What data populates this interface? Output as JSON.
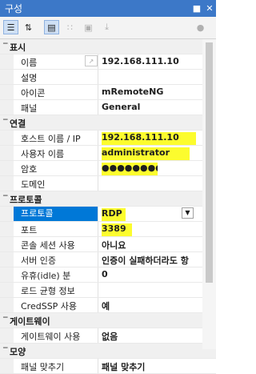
{
  "panel": {
    "title": "구성",
    "pin_icon": "pin-icon",
    "close_icon": "close-icon"
  },
  "toolbar": {
    "buttons": [
      "categorized-icon",
      "alphabetical-icon",
      "properties-icon",
      "inheritance-icon",
      "default-inheritance-icon",
      "hosts-icon",
      "icon-picker-icon"
    ]
  },
  "grid": {
    "rows": [
      {
        "type": "category",
        "label": "표시"
      },
      {
        "type": "prop",
        "name": "이름",
        "value": "192.168.111.10",
        "bold": true
      },
      {
        "type": "prop",
        "name": "설명",
        "value": ""
      },
      {
        "type": "prop",
        "name": "아이콘",
        "value": "mRemoteNG"
      },
      {
        "type": "prop",
        "name": "패널",
        "value": "General"
      },
      {
        "type": "category",
        "label": "연결"
      },
      {
        "type": "prop",
        "name": "호스트 이름 / IP",
        "value": "192.168.111.10",
        "highlight": true
      },
      {
        "type": "prop",
        "name": "사용자 이름",
        "value": "administrator",
        "highlight": true
      },
      {
        "type": "prop",
        "name": "암호",
        "value": "●●●●●●●●",
        "highlight": true
      },
      {
        "type": "prop",
        "name": "도메인",
        "value": ""
      },
      {
        "type": "category",
        "label": "프로토콜"
      },
      {
        "type": "prop",
        "name": "프로토콜",
        "value": "RDP",
        "highlight": true,
        "selected": true,
        "dropdown": true
      },
      {
        "type": "prop",
        "name": "포트",
        "value": "3389",
        "highlight": true
      },
      {
        "type": "prop",
        "name": "콘솔 세션 사용",
        "value": "아니요"
      },
      {
        "type": "prop",
        "name": "서버 인증",
        "value": "인증이 실패하더라도 항"
      },
      {
        "type": "prop",
        "name": "유휴(idle) 분",
        "value": "0"
      },
      {
        "type": "prop",
        "name": "로드 균형 정보",
        "value": ""
      },
      {
        "type": "prop",
        "name": "CredSSP 사용",
        "value": "예"
      },
      {
        "type": "category",
        "label": "게이트웨이"
      },
      {
        "type": "prop",
        "name": "게이트웨이 사용",
        "value": "없음"
      },
      {
        "type": "category",
        "label": "모양"
      },
      {
        "type": "prop",
        "name": "패널 맞추기",
        "value": "패널 맞추기"
      }
    ]
  },
  "colors": {
    "titlebar": "#3c78c8",
    "selected": "#0078d7",
    "highlight": "#fcfc2e"
  }
}
